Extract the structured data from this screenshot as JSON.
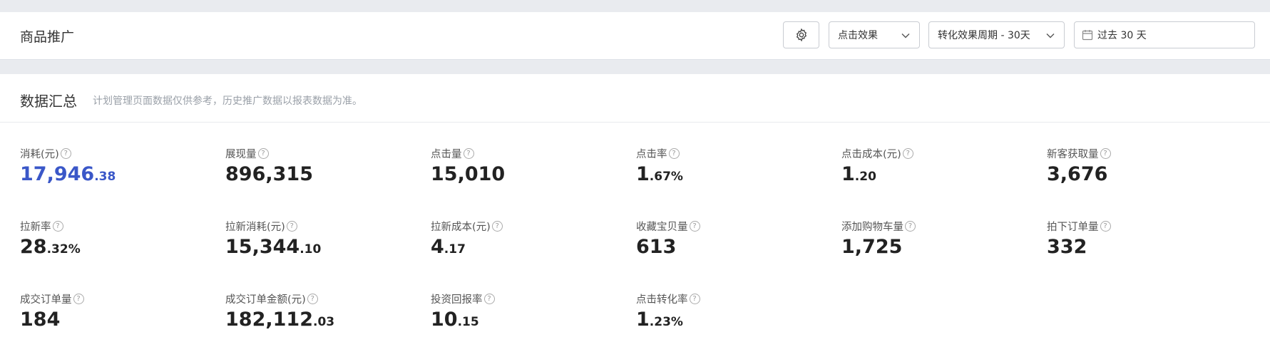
{
  "header": {
    "title": "商品推广",
    "effect_select": "点击效果",
    "period_select": "转化效果周期 - 30天",
    "date_range": "过去 30 天"
  },
  "summary": {
    "title": "数据汇总",
    "note": "计划管理页面数据仅供参考，历史推广数据以报表数据为准。"
  },
  "metrics": [
    {
      "label": "消耗(元)",
      "int": "17,946",
      "dec": ".38"
    },
    {
      "label": "展现量",
      "int": "896,315",
      "dec": ""
    },
    {
      "label": "点击量",
      "int": "15,010",
      "dec": ""
    },
    {
      "label": "点击率",
      "int": "1",
      "dec": ".67%"
    },
    {
      "label": "点击成本(元)",
      "int": "1",
      "dec": ".20"
    },
    {
      "label": "新客获取量",
      "int": "3,676",
      "dec": ""
    },
    {
      "label": "拉新率",
      "int": "28",
      "dec": ".32%"
    },
    {
      "label": "拉新消耗(元)",
      "int": "15,344",
      "dec": ".10"
    },
    {
      "label": "拉新成本(元)",
      "int": "4",
      "dec": ".17"
    },
    {
      "label": "收藏宝贝量",
      "int": "613",
      "dec": ""
    },
    {
      "label": "添加购物车量",
      "int": "1,725",
      "dec": ""
    },
    {
      "label": "拍下订单量",
      "int": "332",
      "dec": ""
    },
    {
      "label": "成交订单量",
      "int": "184",
      "dec": ""
    },
    {
      "label": "成交订单金额(元)",
      "int": "182,112",
      "dec": ".03"
    },
    {
      "label": "投资回报率",
      "int": "10",
      "dec": ".15"
    },
    {
      "label": "点击转化率",
      "int": "1",
      "dec": ".23%"
    }
  ],
  "colors": {
    "accent": "#3a57c8",
    "page_bg": "#e9ebef"
  },
  "icons": [
    "gear-icon",
    "chevron-down-icon",
    "calendar-icon",
    "help-icon"
  ]
}
